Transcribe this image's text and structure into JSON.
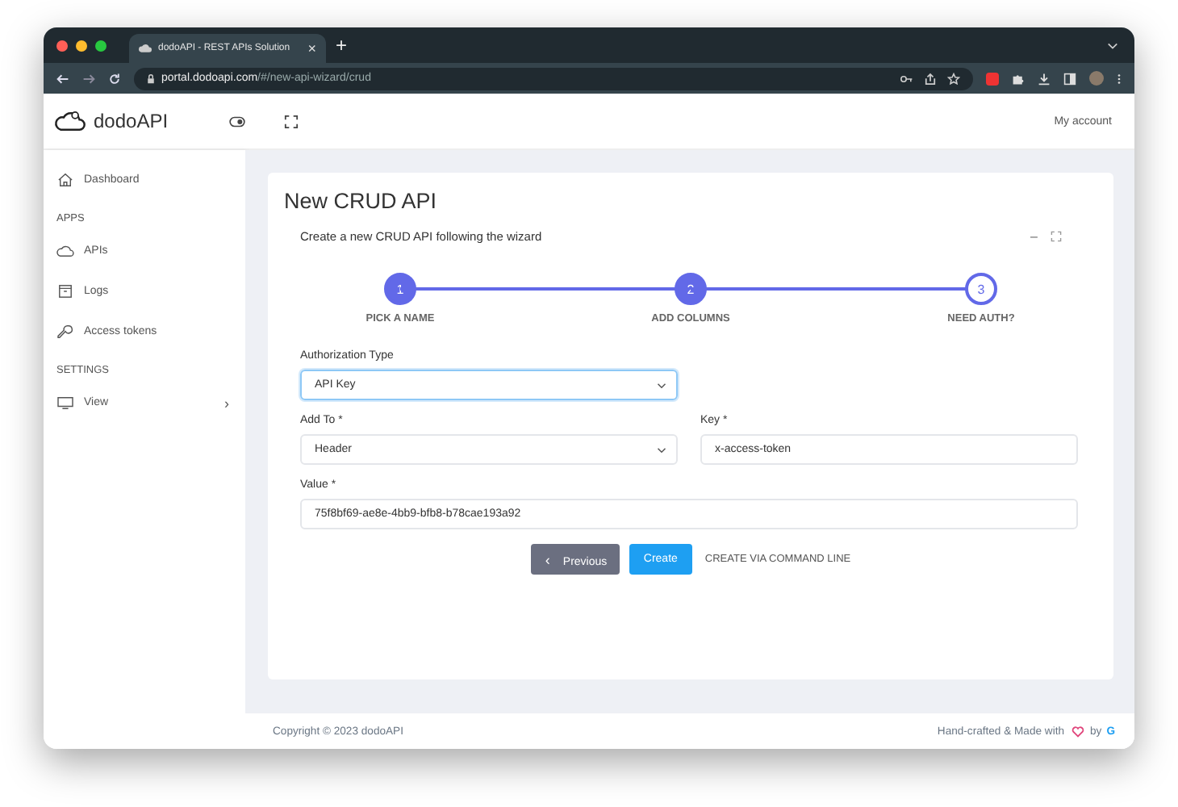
{
  "browser": {
    "tab_title": "dodoAPI - REST APIs Solution",
    "tab_close": "×",
    "new_tab": "+",
    "url_host": "portal.dodoapi.com",
    "url_path": "/#/new-api-wizard/crud"
  },
  "header": {
    "logo": "dodoAPI",
    "account": "My account"
  },
  "sidebar": [
    {
      "kind": "item",
      "label": "Dashboard"
    },
    {
      "kind": "section",
      "label": "APPS"
    },
    {
      "kind": "item",
      "label": "APIs"
    },
    {
      "kind": "item",
      "label": "Logs"
    },
    {
      "kind": "item",
      "label": "Access tokens"
    },
    {
      "kind": "section",
      "label": "SETTINGS"
    },
    {
      "kind": "item",
      "label": "View",
      "chevron": "›"
    }
  ],
  "card": {
    "title": "New CRUD API",
    "subtitle": "Create a new CRUD API following the wizard",
    "minimize": "–"
  },
  "steps": [
    {
      "number": "1",
      "label": "PICK A NAME",
      "done": true
    },
    {
      "number": "2",
      "label": "ADD COLUMNS",
      "done": true
    },
    {
      "number": "3",
      "label": "NEED AUTH?",
      "done": false
    }
  ],
  "fields": [
    {
      "kind": "select",
      "label": "Authorization Type",
      "value": "API Key",
      "focused": true
    },
    {
      "kind": "select",
      "label": "Add To *",
      "value": "Header",
      "focused": false
    },
    {
      "kind": "text",
      "label": "Key *",
      "value": "x-access-token",
      "focused": false
    },
    {
      "kind": "text",
      "label": "Value *",
      "value": "75f8bf69-ae8e-4bb9-bfb8-b78cae193a92",
      "focused": false
    }
  ],
  "buttons": [
    {
      "kind": "secondary",
      "label": "Previous",
      "icon": "‹"
    },
    {
      "kind": "primary",
      "label": "Create"
    },
    {
      "kind": "link",
      "label": "CREATE VIA COMMAND LINE"
    }
  ],
  "footer": {
    "copyright": "Copyright © 2023 dodoAPI",
    "credit_before": "Hand-crafted & Made with",
    "credit_by": "by",
    "credit_name": "G"
  }
}
